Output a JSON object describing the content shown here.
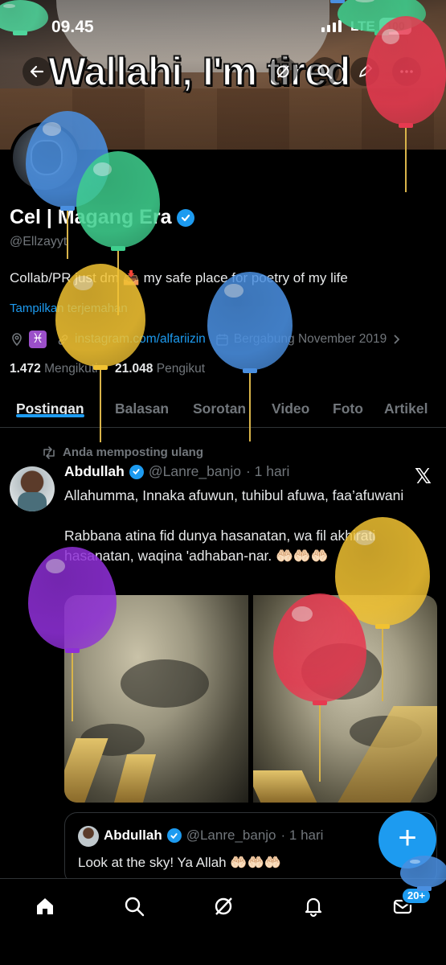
{
  "status": {
    "time": "09.45",
    "network": "LTE",
    "battery": "100"
  },
  "banner": {
    "text": "Wallahi, I'm tired"
  },
  "profile": {
    "name": "Cel | Magang Era",
    "handle": "@Ellzayyt",
    "bio": "Collab/PR just dm 📥 my safe place for poetry of my life",
    "translate_label": "Tampilkan terjemahan",
    "zodiac": "♓",
    "link": "instagram.com/alfariizin",
    "joined": "Bergabung November 2019",
    "following_count": "1.472",
    "following_label": "Mengikuti",
    "followers_count": "21.048",
    "followers_label": "Pengikut"
  },
  "tabs": [
    "Postingan",
    "Balasan",
    "Sorotan",
    "Video",
    "Foto",
    "Artikel"
  ],
  "post": {
    "repost_label": "Anda memposting ulang",
    "author": "Abdullah",
    "handle": "@Lanre_banjo",
    "time": "· 1 hari",
    "text": "Allahumma, Innaka afuwun, tuhibul afuwa, faa’afuwani\n\nRabbana atina fid dunya hasanatan, wa fil akhirati hasanatan, waqina 'adhaban-nar. 🤲🏻🤲🏻🤲🏻"
  },
  "quote": {
    "author": "Abdullah",
    "handle": "@Lanre_banjo",
    "time": "· 1 hari",
    "text": "Look at the sky! Ya Allah 🤲🏻🤲🏻🤲🏻"
  },
  "fab_label": "+",
  "nav": {
    "messages_badge": "20+"
  },
  "colors": {
    "accent": "#1d9bf0",
    "background": "#000000",
    "muted": "#71767b"
  },
  "icons": [
    "back-arrow-icon",
    "grok-icon",
    "search-icon",
    "edit-icon",
    "more-icon",
    "verified-icon",
    "location-icon",
    "link-icon",
    "calendar-icon",
    "chevron-right-icon",
    "repost-icon",
    "x-logo-icon",
    "home-icon",
    "notifications-icon",
    "messages-icon"
  ]
}
